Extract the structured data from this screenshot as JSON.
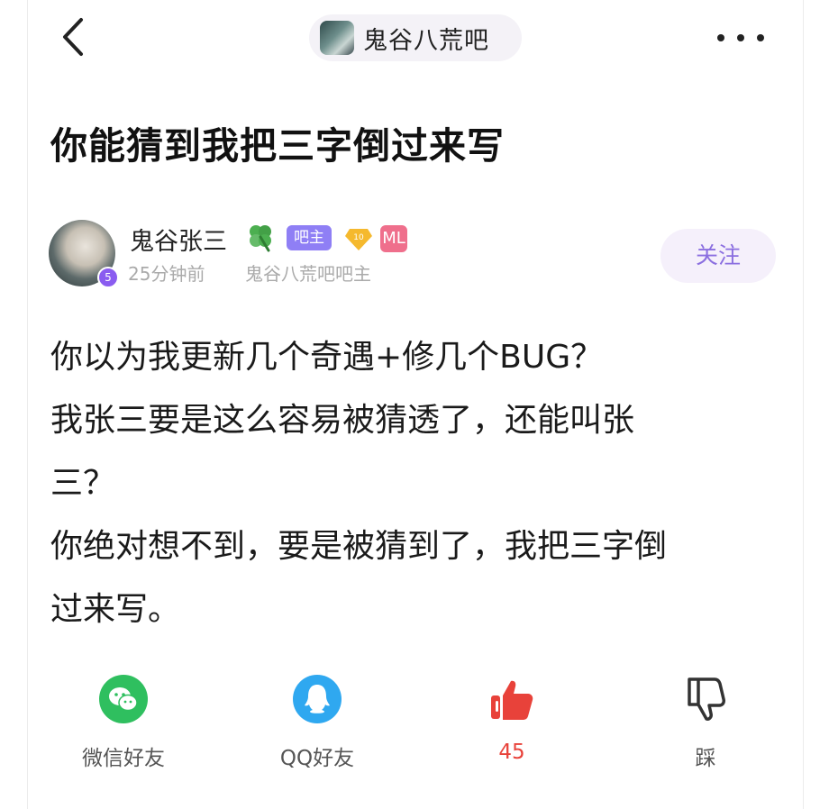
{
  "nav": {
    "forum_name": "鬼谷八荒吧"
  },
  "post": {
    "title": "你能猜到我把三字倒过来写",
    "author": {
      "name": "鬼谷张三",
      "level": "5",
      "badge_role": "吧主",
      "diamond_level": "10",
      "sign_badge": "ML",
      "time": "25分钟前",
      "role_desc": "鬼谷八荒吧吧主"
    },
    "follow_label": "关注",
    "body_lines": [
      "你以为我更新几个奇遇+修几个BUG？",
      "我张三要是这么容易被猜透了，还能叫张",
      "三？",
      "你绝对想不到，要是被猜到了，我把三字倒",
      "过来写。"
    ]
  },
  "actions": {
    "wechat_label": "微信好友",
    "qq_label": "QQ好友",
    "like_count": "45",
    "dislike_label": "踩"
  },
  "colors": {
    "accent_purple": "#8b6fe0",
    "like_red": "#e8423a",
    "wechat_green": "#2fbf5f",
    "qq_blue": "#2fa8f0"
  }
}
